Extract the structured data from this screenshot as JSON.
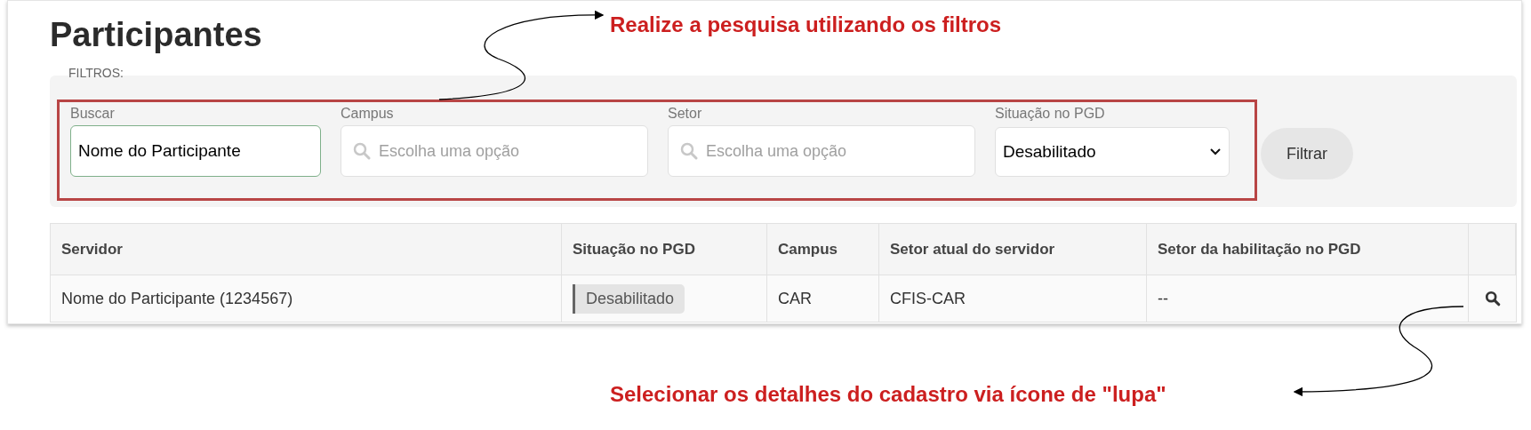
{
  "page_title": "Participantes",
  "filters": {
    "label": "FILTROS:",
    "fields": [
      {
        "kind": "text",
        "label": "Buscar",
        "value": "Nome do Participante"
      },
      {
        "kind": "search",
        "label": "Campus",
        "placeholder": "Escolha uma opção"
      },
      {
        "kind": "search",
        "label": "Setor",
        "placeholder": "Escolha uma opção"
      },
      {
        "kind": "select",
        "label": "Situação no PGD",
        "value": "Desabilitado"
      }
    ],
    "button": "Filtrar"
  },
  "table": {
    "columns": [
      "Servidor",
      "Situação no PGD",
      "Campus",
      "Setor atual do servidor",
      "Setor da habilitação no PGD"
    ],
    "rows": [
      {
        "servidor": "Nome do Participante (1234567)",
        "situacao": "Desabilitado",
        "campus": "CAR",
        "setor_atual": "CFIS-CAR",
        "setor_habilitacao": "--"
      }
    ]
  },
  "annotations": [
    "Realize a pesquisa utilizando os filtros",
    "Selecionar os detalhes do cadastro via ícone de \"lupa\""
  ]
}
